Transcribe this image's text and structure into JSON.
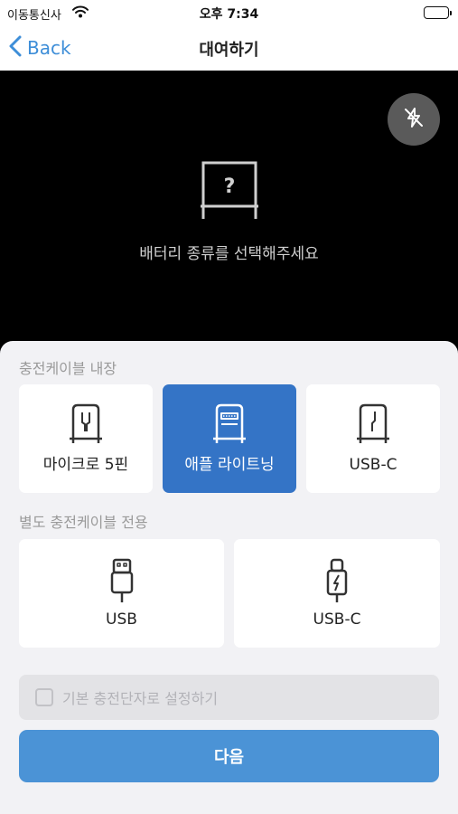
{
  "status": {
    "carrier": "이동통신사",
    "time": "오후 7:34",
    "icons": [
      "wifi-icon",
      "battery-icon"
    ]
  },
  "nav": {
    "back_label": "Back",
    "title": "대여하기",
    "accent": "#3e8ed8"
  },
  "camera": {
    "prompt": "배터리 종류를 선택해주세요",
    "flash_icon": "flash-off-icon",
    "placeholder_icon": "question-icon"
  },
  "built_in": {
    "label": "충전케이블 내장",
    "options": [
      {
        "label": "마이크로 5핀",
        "icon": "micro-5pin-icon",
        "selected": false
      },
      {
        "label": "애플 라이트닝",
        "icon": "apple-lightning-icon",
        "selected": true
      },
      {
        "label": "USB-C",
        "icon": "usb-c-builtin-icon",
        "selected": false
      }
    ]
  },
  "separate": {
    "label": "별도 충전케이블 전용",
    "options": [
      {
        "label": "USB",
        "icon": "usb-icon",
        "selected": false
      },
      {
        "label": "USB-C",
        "icon": "usb-c-icon",
        "selected": false
      }
    ]
  },
  "default_connector": {
    "label": "기본 충전단자로 설정하기",
    "checked": false
  },
  "next_button": {
    "label": "다음",
    "color": "#4b93d6"
  },
  "selected_color": "#3474c6"
}
